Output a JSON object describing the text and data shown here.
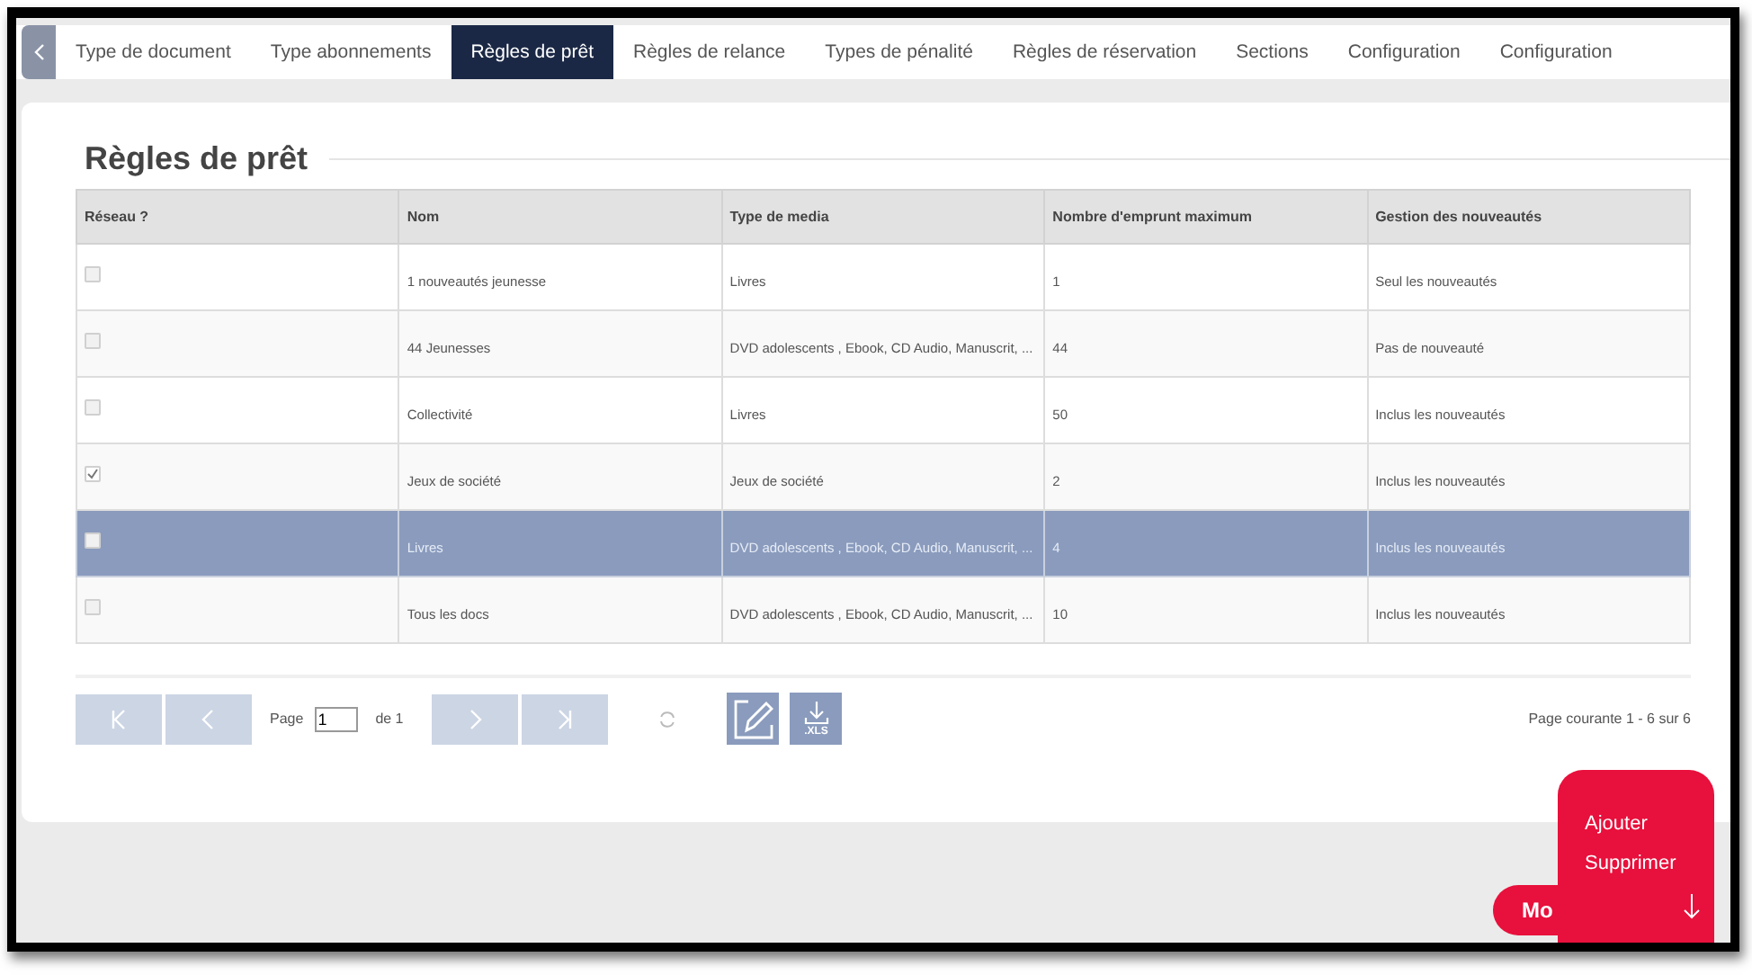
{
  "tabs": [
    {
      "label": "Type de document",
      "selected": false
    },
    {
      "label": "Type abonnements",
      "selected": false
    },
    {
      "label": "Règles de prêt",
      "selected": true
    },
    {
      "label": "Règles de relance",
      "selected": false
    },
    {
      "label": "Types de pénalité",
      "selected": false
    },
    {
      "label": "Règles de réservation",
      "selected": false
    },
    {
      "label": "Sections",
      "selected": false
    },
    {
      "label": "Configuration",
      "selected": false
    },
    {
      "label": "Configuration",
      "selected": false
    }
  ],
  "title": "Règles de prêt",
  "table": {
    "columns": [
      "Réseau ?",
      "Nom",
      "Type de media",
      "Nombre d'emprunt maximum",
      "Gestion des nouveautés"
    ],
    "rows": [
      {
        "checked": false,
        "selected": false,
        "cells": [
          "",
          "1 nouveautés jeunesse",
          "Livres",
          "1",
          "Seul les nouveautés"
        ]
      },
      {
        "checked": false,
        "selected": false,
        "cells": [
          "",
          "44 Jeunesses",
          "DVD adolescents , Ebook, CD Audio, Manuscrit, ...",
          "44",
          "Pas de nouveauté"
        ]
      },
      {
        "checked": false,
        "selected": false,
        "cells": [
          "",
          "Collectivité",
          "Livres",
          "50",
          "Inclus les nouveautés"
        ]
      },
      {
        "checked": true,
        "selected": false,
        "cells": [
          "",
          "Jeux de société",
          "Jeux de société",
          "2",
          "Inclus les nouveautés"
        ]
      },
      {
        "checked": false,
        "selected": true,
        "cells": [
          "",
          "Livres",
          "DVD adolescents , Ebook, CD Audio, Manuscrit, ...",
          "4",
          "Inclus les nouveautés"
        ]
      },
      {
        "checked": false,
        "selected": false,
        "cells": [
          "",
          "Tous les docs",
          "DVD adolescents , Ebook, CD Audio, Manuscrit, ...",
          "10",
          "Inclus les nouveautés"
        ]
      }
    ]
  },
  "pager": {
    "page_label": "Page",
    "page_value": "1",
    "of_label": "de 1",
    "export_label": ".XLS",
    "summary": "Page courante 1 - 6 sur 6"
  },
  "menu": {
    "button_label": "Mo",
    "items": [
      "Ajouter",
      "Supprimer"
    ]
  }
}
